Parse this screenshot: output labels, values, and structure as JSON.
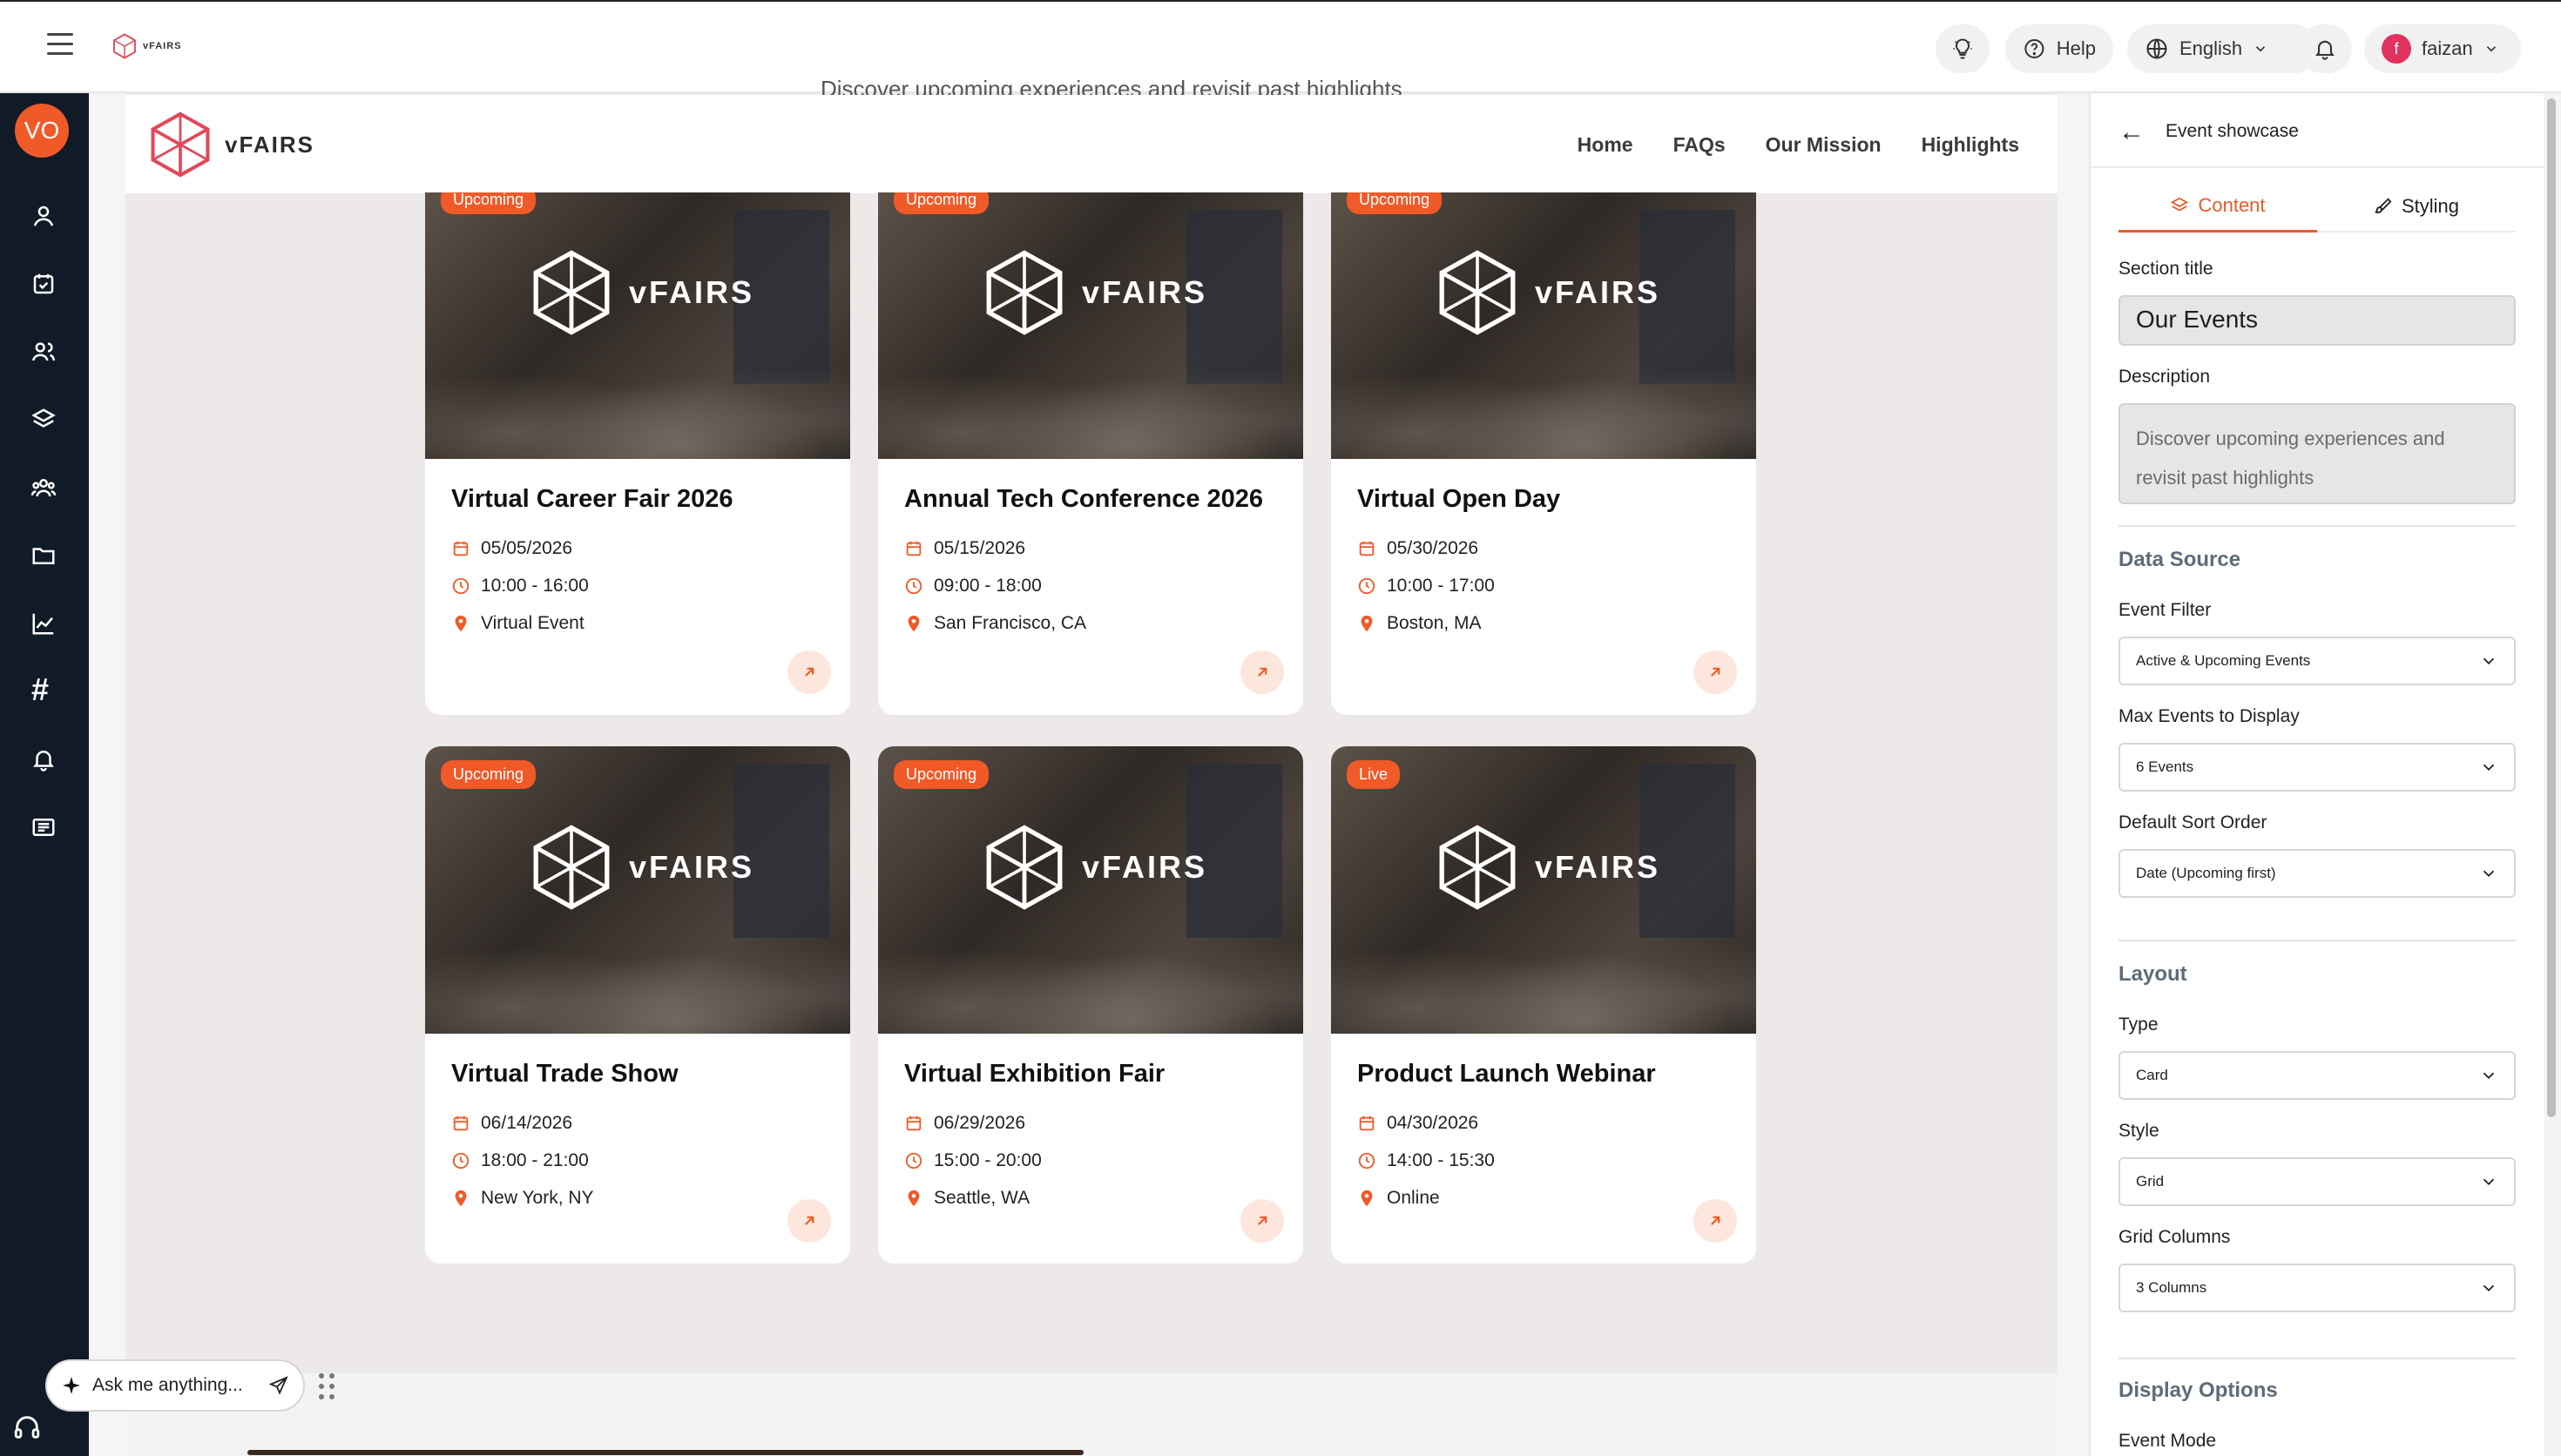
{
  "topbar": {
    "logo_text": "vFAIRS",
    "help_label": "Help",
    "language_label": "English",
    "user_initial": "f",
    "user_name": "faizan"
  },
  "leftnav": {
    "avatar_initials": "VO"
  },
  "site": {
    "logo_text": "vFAIRS",
    "nav": [
      "Home",
      "FAQs",
      "Our Mission",
      "Highlights"
    ],
    "peek_text": "Discover upcoming experiences and revisit past highlights"
  },
  "cards": [
    {
      "badge": "Upcoming",
      "title": "Virtual Career Fair 2026",
      "date": "05/05/2026",
      "time": "10:00 - 16:00",
      "location": "Virtual Event",
      "logo_text": "vFAIRS"
    },
    {
      "badge": "Upcoming",
      "title": "Annual Tech Conference 2026",
      "date": "05/15/2026",
      "time": "09:00 - 18:00",
      "location": "San Francisco, CA",
      "logo_text": "vFAIRS"
    },
    {
      "badge": "Upcoming",
      "title": "Virtual Open Day",
      "date": "05/30/2026",
      "time": "10:00 - 17:00",
      "location": "Boston, MA",
      "logo_text": "vFAIRS"
    },
    {
      "badge": "Upcoming",
      "title": "Virtual Trade Show",
      "date": "06/14/2026",
      "time": "18:00 - 21:00",
      "location": "New York, NY",
      "logo_text": "vFAIRS"
    },
    {
      "badge": "Upcoming",
      "title": "Virtual Exhibition Fair",
      "date": "06/29/2026",
      "time": "15:00 - 20:00",
      "location": "Seattle, WA",
      "logo_text": "vFAIRS"
    },
    {
      "badge": "Live",
      "title": "Product Launch Webinar",
      "date": "04/30/2026",
      "time": "14:00 - 15:30",
      "location": "Online",
      "logo_text": "vFAIRS"
    }
  ],
  "askme": {
    "placeholder": "Ask me anything..."
  },
  "panel": {
    "header_title": "Event showcase",
    "tab_content": "Content",
    "tab_styling": "Styling",
    "section_title_label": "Section title",
    "section_title_value": "Our Events",
    "description_label": "Description",
    "description_value": "Discover upcoming experiences and revisit past highlights",
    "data_source_heading": "Data Source",
    "event_filter_label": "Event Filter",
    "event_filter_value": "Active & Upcoming Events",
    "max_events_label": "Max Events to Display",
    "max_events_value": "6 Events",
    "sort_order_label": "Default Sort Order",
    "sort_order_value": "Date (Upcoming first)",
    "layout_heading": "Layout",
    "type_label": "Type",
    "type_value": "Card",
    "style_label": "Style",
    "style_value": "Grid",
    "grid_columns_label": "Grid Columns",
    "grid_columns_value": "3 Columns",
    "display_options_heading": "Display Options",
    "event_mode_label": "Event Mode"
  },
  "colors": {
    "accent": "#f05a28",
    "nav_bg": "#111a27",
    "badge": "#f05a28"
  }
}
